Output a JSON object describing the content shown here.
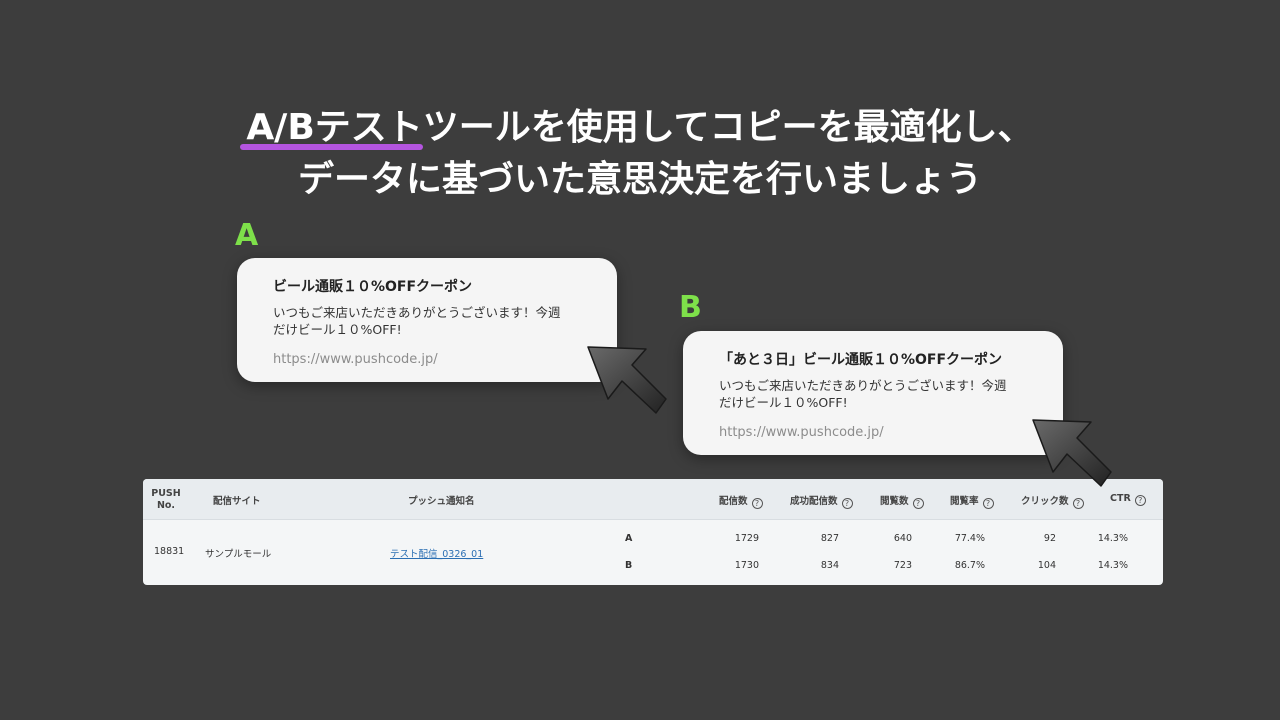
{
  "headline": {
    "highlight": "A/Bテスト",
    "line1_rest": "ツールを使用してコピーを最適化し、",
    "line2": "データに基づいた意思決定を行いましょう"
  },
  "colors": {
    "background": "#3d3d3d",
    "accent_green": "#7ee04a",
    "highlight_purple": "#b455e0",
    "link": "#2b6fb3"
  },
  "variant_a": {
    "label": "A",
    "title": "ビール通販１０%OFFクーポン",
    "body_line1": "いつもご来店いただきありがとうございます！今週",
    "body_line2": "だけビール１０%OFF!",
    "url": "https://www.pushcode.jp/"
  },
  "variant_b": {
    "label": "B",
    "title": "「あと３日」ビール通販１０%OFFクーポン",
    "body_line1": "いつもご来店いただきありがとうございます！今週",
    "body_line2": "だけビール１０%OFF!",
    "url": "https://www.pushcode.jp/"
  },
  "table": {
    "headers": {
      "push_no_1": "PUSH",
      "push_no_2": "No.",
      "site": "配信サイト",
      "push_name": "プッシュ通知名",
      "delivered": "配信数",
      "success": "成功配信数",
      "views": "閲覧数",
      "view_rate": "閲覧率",
      "clicks": "クリック数",
      "ctr": "CTR"
    },
    "row": {
      "push_no": "18831",
      "site": "サンプルモール",
      "push_name": "テスト配信_0326_01",
      "variants": [
        {
          "label": "A",
          "delivered": "1729",
          "success": "827",
          "views": "640",
          "view_rate": "77.4%",
          "clicks": "92",
          "ctr": "14.3%"
        },
        {
          "label": "B",
          "delivered": "1730",
          "success": "834",
          "views": "723",
          "view_rate": "86.7%",
          "clicks": "104",
          "ctr": "14.3%"
        }
      ]
    }
  }
}
